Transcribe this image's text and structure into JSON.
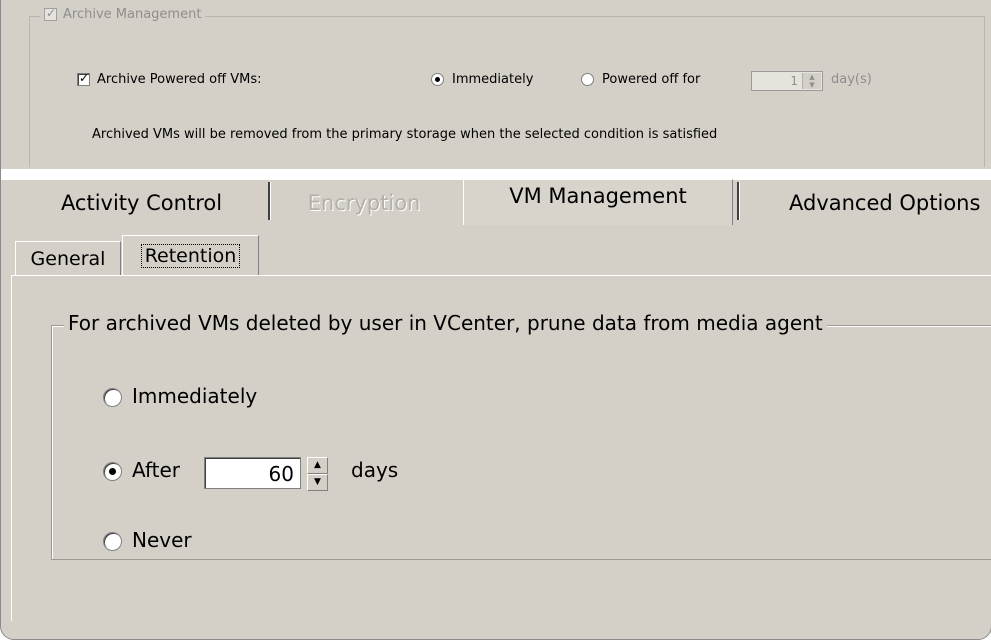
{
  "archive": {
    "group_title": "Archive Management",
    "powered_off_label": "Archive Powered off VMs:",
    "immediately_label": "Immediately",
    "powered_off_for_label": "Powered off for",
    "days_value": "1",
    "days_unit": "day(s)",
    "info_text": "Archived VMs will be removed from the primary storage when the selected condition is satisfied"
  },
  "tabs": [
    {
      "label": "Activity Control",
      "state": "normal"
    },
    {
      "label": "Encryption",
      "state": "disabled"
    },
    {
      "label": "VM Management",
      "state": "active"
    },
    {
      "label": "Advanced Options",
      "state": "normal"
    }
  ],
  "subtabs": [
    {
      "label": "General"
    },
    {
      "label": "Retention"
    }
  ],
  "retention": {
    "group_title": "For archived VMs deleted by user in VCenter, prune data from media agent",
    "options": [
      {
        "label": "Immediately",
        "selected": false
      },
      {
        "label": "After",
        "selected": true
      },
      {
        "label": "Never",
        "selected": false
      }
    ],
    "after_days_value": "60",
    "after_days_unit": "days"
  }
}
